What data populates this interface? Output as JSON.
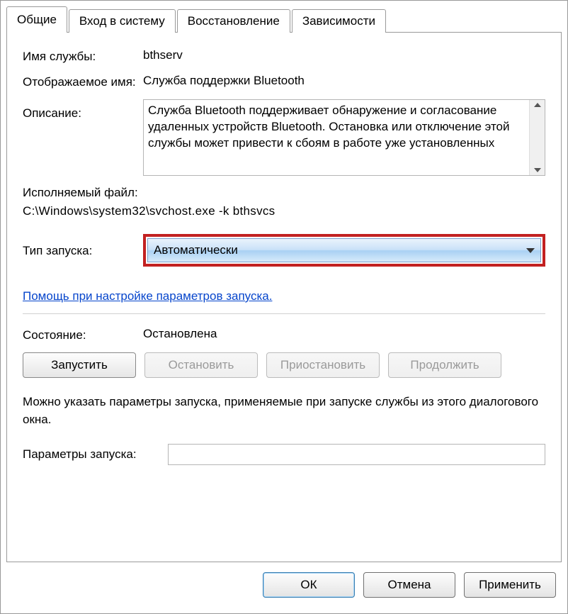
{
  "tabs": {
    "general": "Общие",
    "logon": "Вход в систему",
    "recovery": "Восстановление",
    "dependencies": "Зависимости"
  },
  "fields": {
    "service_name_label": "Имя службы:",
    "service_name_value": "bthserv",
    "display_name_label": "Отображаемое имя:",
    "display_name_value": "Служба поддержки Bluetooth",
    "description_label": "Описание:",
    "description_value": "Служба Bluetooth поддерживает обнаружение и согласование удаленных устройств Bluetooth. Остановка или отключение этой службы может привести к сбоям в работе уже установленных",
    "exec_label": "Исполняемый файл:",
    "exec_value": "C:\\Windows\\system32\\svchost.exe -k bthsvcs",
    "startup_type_label": "Тип запуска:",
    "startup_type_value": "Автоматически",
    "help_link": "Помощь при настройке параметров запуска.",
    "status_label": "Состояние:",
    "status_value": "Остановлена",
    "note": "Можно указать параметры запуска, применяемые при запуске службы из этого диалогового окна.",
    "start_params_label": "Параметры запуска:",
    "start_params_value": ""
  },
  "buttons": {
    "start": "Запустить",
    "stop": "Остановить",
    "pause": "Приостановить",
    "resume": "Продолжить",
    "ok": "ОК",
    "cancel": "Отмена",
    "apply": "Применить"
  },
  "highlight_color": "#c22121"
}
